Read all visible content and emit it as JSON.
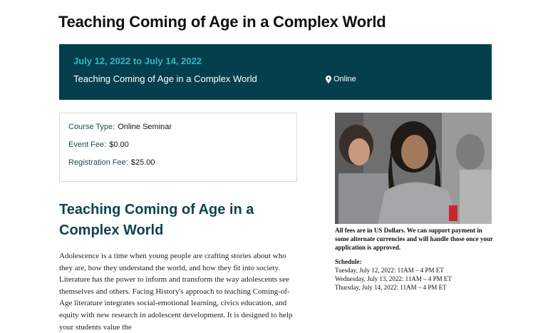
{
  "page": {
    "title": "Teaching Coming of Age in a Complex World"
  },
  "banner": {
    "dates": "July 12, 2022 to July 14, 2022",
    "title": "Teaching Coming of Age in a Complex World",
    "location": "Online",
    "location_icon": "map-pin-icon",
    "background_color": "#053f4e",
    "dates_color": "#35b5c4"
  },
  "info": {
    "course_type_label": "Course Type:",
    "course_type_value": "Online Seminar",
    "event_fee_label": "Event Fee:",
    "event_fee_value": "$0.00",
    "registration_fee_label": "Registration Fee:",
    "registration_fee_value": "$25.00"
  },
  "main": {
    "section_title": "Teaching Coming of Age in a Complex World",
    "description": "Adolescence is a time when young people are crafting stories about who they are, how they understand the world, and how they fit into society. Literature has the power to inform and transform the way adolescents see themselves and others. Facing History's approach to teaching Coming-of-Age literature integrates social-emotional learning, civics education, and equity with new research in adolescent development. It is designed to help your students value the"
  },
  "sidebar": {
    "fees_note": "All fees are in US Dollars. We can support payment in some alternate currencies and will handle those once your application is approved.",
    "schedule_heading": "Schedule:",
    "schedule": [
      "Tuesday, July 12, 2022: 11AM – 4 PM ET",
      "Wednesday, July 13, 2022: 11AM – 4 PM ET",
      "Thursday, July 14, 2022: 11AM – 4 PM ET"
    ]
  }
}
